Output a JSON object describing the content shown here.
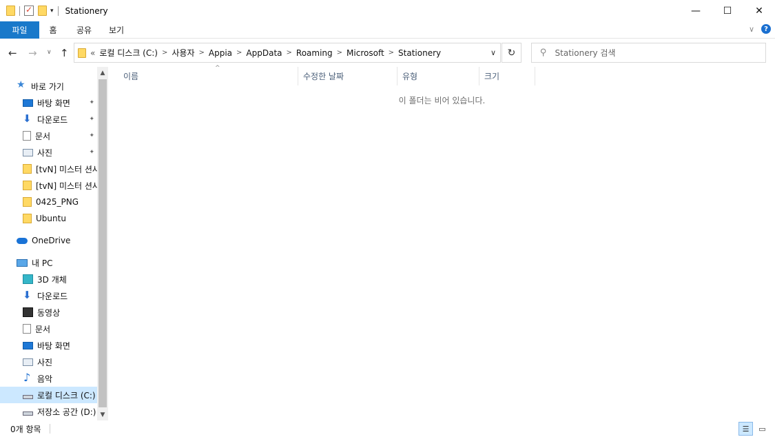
{
  "window": {
    "title": "Stationery",
    "controls": {
      "minimize": "—",
      "maximize": "☐",
      "close": "✕"
    }
  },
  "ribbon": {
    "tabs": [
      "파일",
      "홈",
      "공유",
      "보기"
    ],
    "collapse_glyph": "∨",
    "help_glyph": "?"
  },
  "nav": {
    "back": "←",
    "forward": "→",
    "recent": "∨",
    "up": "↑",
    "overflow": "«",
    "breadcrumbs": [
      "로컬 디스크 (C:)",
      "사용자",
      "Appia",
      "AppData",
      "Roaming",
      "Microsoft",
      "Stationery"
    ],
    "crumb_sep": ">",
    "refresh": "↻",
    "search_placeholder": "Stationery 검색"
  },
  "sidebar": {
    "items": [
      {
        "label": "바로 가기",
        "icon": "star-icon",
        "level": "top"
      },
      {
        "label": "바탕 화면",
        "icon": "desktop-icon",
        "level": "sub",
        "pinned": true
      },
      {
        "label": "다운로드",
        "icon": "download-icon",
        "level": "sub",
        "pinned": true
      },
      {
        "label": "문서",
        "icon": "document-icon",
        "level": "sub",
        "pinned": true
      },
      {
        "label": "사진",
        "icon": "pictures-icon",
        "level": "sub",
        "pinned": true
      },
      {
        "label": "[tvN] 미스터 션샤",
        "icon": "folder-icon",
        "level": "sub"
      },
      {
        "label": "[tvN] 미스터 션샤",
        "icon": "folder-icon",
        "level": "sub"
      },
      {
        "label": "0425_PNG",
        "icon": "folder-icon",
        "level": "sub"
      },
      {
        "label": "Ubuntu",
        "icon": "folder-icon",
        "level": "sub"
      },
      {
        "label": "OneDrive",
        "icon": "onedrive-icon",
        "level": "top"
      },
      {
        "label": "내 PC",
        "icon": "pc-icon",
        "level": "top"
      },
      {
        "label": "3D 개체",
        "icon": "3d-objects-icon",
        "level": "sub"
      },
      {
        "label": "다운로드",
        "icon": "download-icon",
        "level": "sub"
      },
      {
        "label": "동영상",
        "icon": "video-icon",
        "level": "sub"
      },
      {
        "label": "문서",
        "icon": "document-icon",
        "level": "sub"
      },
      {
        "label": "바탕 화면",
        "icon": "desktop-icon",
        "level": "sub"
      },
      {
        "label": "사진",
        "icon": "pictures-icon",
        "level": "sub"
      },
      {
        "label": "음악",
        "icon": "music-icon",
        "level": "sub"
      },
      {
        "label": "로컬 디스크 (C:)",
        "icon": "drive-icon",
        "level": "sub",
        "selected": true
      },
      {
        "label": "저장소 공간 (D:)",
        "icon": "drive-icon",
        "level": "sub"
      }
    ],
    "pin_glyph": "📌"
  },
  "content": {
    "columns": [
      "이름",
      "수정한 날짜",
      "유형",
      "크기"
    ],
    "sort_glyph": "^",
    "empty_message": "이 폴더는 비어 있습니다."
  },
  "statusbar": {
    "item_count": "0개 항목",
    "details_view_glyph": "☰",
    "tiles_view_glyph": "▭"
  }
}
